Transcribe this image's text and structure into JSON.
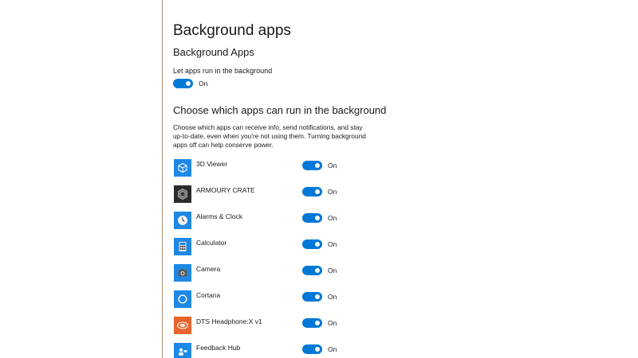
{
  "page": {
    "title": "Background apps",
    "section_heading": "Background Apps",
    "master_setting_label": "Let apps run in the background",
    "master_toggle_state": "On",
    "apps_heading": "Choose which apps can run in the background",
    "description": "Choose which apps can receive info, send notifications, and stay up-to-date, even when you're not using them. Turning background apps off can help conserve power."
  },
  "apps": [
    {
      "name": "3D Viewer",
      "state": "On",
      "icon": "cube-icon",
      "icon_color": "#1e88e5"
    },
    {
      "name": "ARMOURY CRATE",
      "state": "On",
      "icon": "armoury-crate-icon",
      "icon_color": "#2b2b2b"
    },
    {
      "name": "Alarms & Clock",
      "state": "On",
      "icon": "clock-icon",
      "icon_color": "#1e88e5"
    },
    {
      "name": "Calculator",
      "state": "On",
      "icon": "calculator-icon",
      "icon_color": "#1e88e5"
    },
    {
      "name": "Camera",
      "state": "On",
      "icon": "camera-icon",
      "icon_color": "#1e88e5"
    },
    {
      "name": "Cortana",
      "state": "On",
      "icon": "cortana-icon",
      "icon_color": "#1e88e5"
    },
    {
      "name": "DTS Headphone:X v1",
      "state": "On",
      "icon": "dts-icon",
      "icon_color": "#e8642c"
    },
    {
      "name": "Feedback Hub",
      "state": "On",
      "icon": "feedback-hub-icon",
      "icon_color": "#1e88e5"
    }
  ],
  "colors": {
    "toggle_on": "#0078d7",
    "divider": "#a88f74"
  }
}
